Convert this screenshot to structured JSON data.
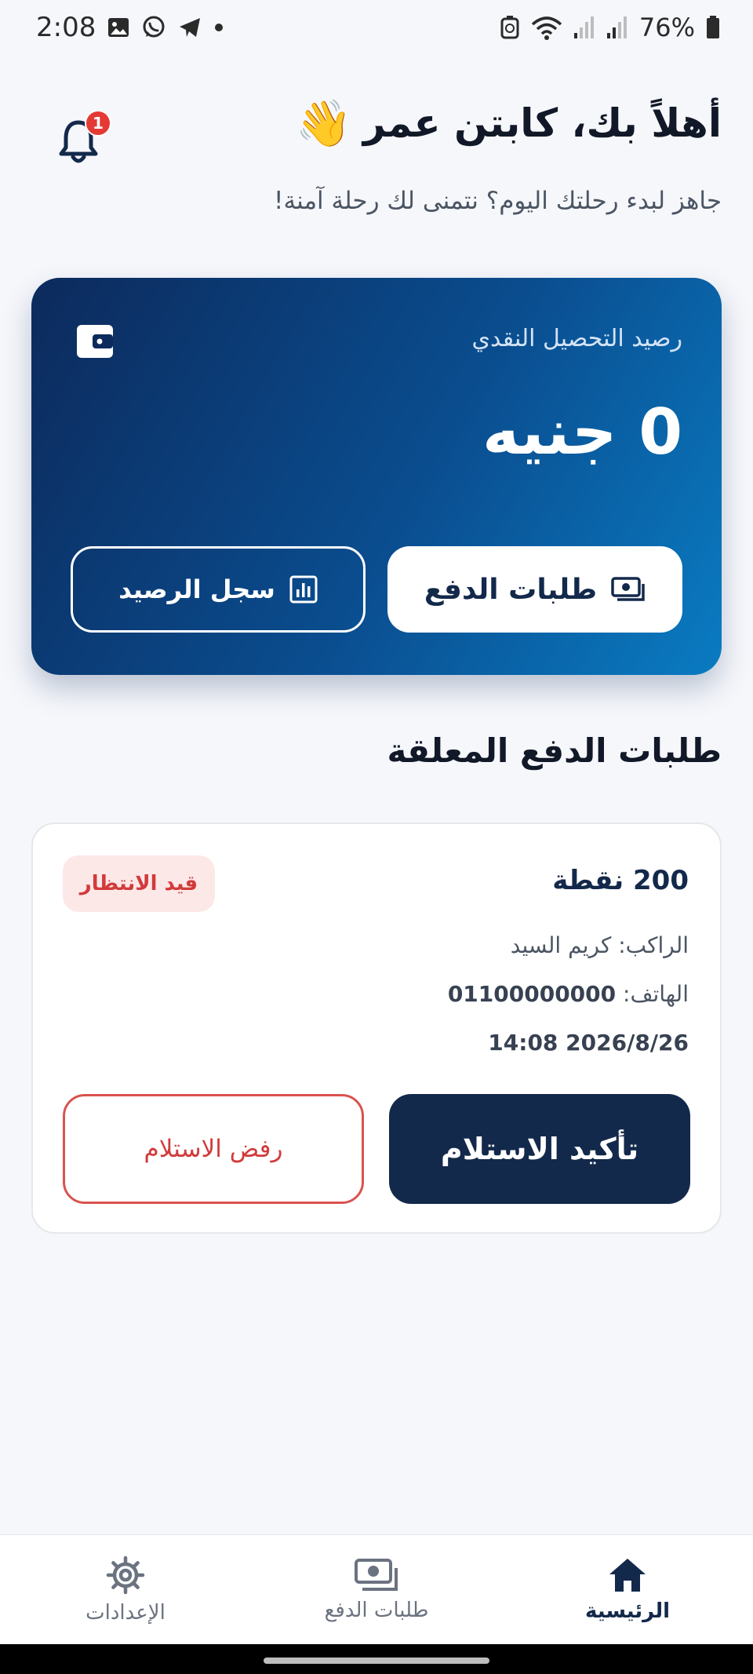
{
  "status_bar": {
    "time": "2:08",
    "battery_percent": "76%",
    "icons": [
      "gallery-icon",
      "whatsapp-icon",
      "telegram-icon",
      "dot-icon",
      "recycle-icon",
      "wifi-icon",
      "signal-icon",
      "signal-icon",
      "battery-icon"
    ]
  },
  "header": {
    "greeting": "أهلاً بك، كابتن عمر",
    "emoji": "👋",
    "subtitle": "جاهز لبدء رحلتك اليوم؟ نتمنى لك رحلة آمنة!",
    "notification_count": "1"
  },
  "balance_card": {
    "label": "رصيد التحصيل النقدي",
    "amount": "0 جنيه",
    "payment_requests_button": "طلبات الدفع",
    "balance_history_button": "سجل الرصيد"
  },
  "pending_section": {
    "title": "طلبات الدفع المعلقة"
  },
  "request": {
    "points": "200 نقطة",
    "status": "قيد الانتظار",
    "rider_label": "الراكب:",
    "rider_name": "كريم السيد",
    "phone_label": "الهاتف:",
    "phone": "01100000000",
    "datetime": "14:08 2026/8/26",
    "confirm_button": "تأكيد الاستلام",
    "reject_button": "رفض الاستلام"
  },
  "bottom_nav": {
    "home": "الرئيسية",
    "payment_requests": "طلبات الدفع",
    "settings": "الإعدادات",
    "active": "home"
  },
  "colors": {
    "primary": "#13294b",
    "card_gradient_start": "#0c2a5c",
    "card_gradient_end": "#0a7bc2",
    "danger": "#d23b3b",
    "badge_bg": "#fde8e8",
    "background": "#f6f7fb"
  }
}
